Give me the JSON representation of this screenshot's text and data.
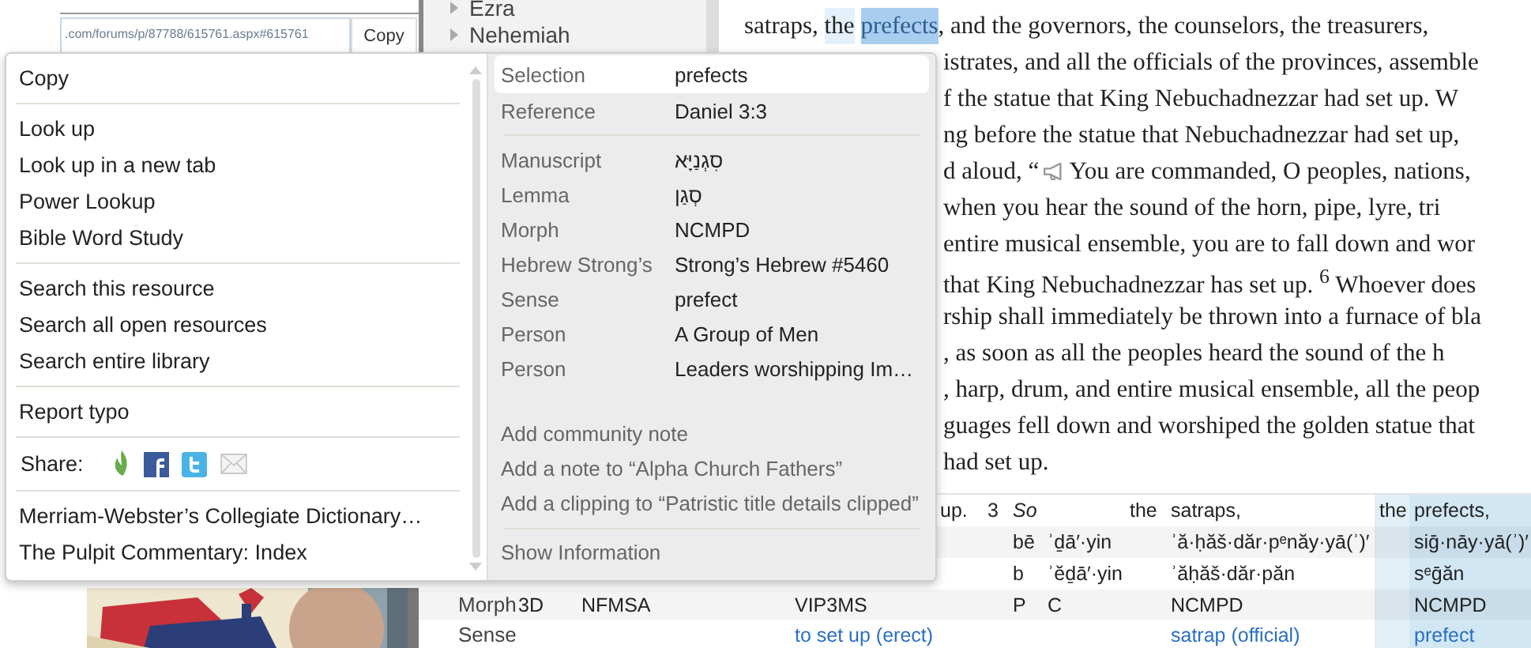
{
  "browser": {
    "url": ".com/forums/p/87788/615761.aspx#615761",
    "copy_button": "Copy"
  },
  "tree": [
    {
      "label": "Ezra",
      "expanded": false
    },
    {
      "label": "Nehemiah",
      "expanded": false
    }
  ],
  "reading": {
    "lines": [
      {
        "segments": [
          {
            "kind": "text",
            "text": "satraps, ",
            "selected": false,
            "hover": false
          },
          {
            "kind": "text",
            "text": "the",
            "selected": false,
            "hover": true
          },
          {
            "kind": "text",
            "text": "prefects",
            "selected": true,
            "hover": false
          },
          {
            "kind": "text",
            "text": ", and the governors, the counselors, the treasurers,",
            "selected": false,
            "hover": false
          }
        ]
      },
      {
        "segments": [
          {
            "kind": "text",
            "text": "istrates, and all the officials of the provinces, assemble",
            "selected": false,
            "hover": false
          }
        ]
      },
      {
        "segments": [
          {
            "kind": "text",
            "text": "f the statue that King Nebuchadnezzar had set up. W",
            "selected": false,
            "hover": false
          }
        ]
      },
      {
        "segments": [
          {
            "kind": "text",
            "text": "ng before the statue that Nebuchadnezzar had set up,",
            "selected": false,
            "hover": false
          }
        ]
      },
      {
        "segments": [
          {
            "kind": "text",
            "text": "d aloud, “",
            "selected": false,
            "hover": false
          },
          {
            "kind": "icon"
          },
          {
            "kind": "text",
            "text": "You are commanded, O peoples, nations,",
            "selected": false,
            "hover": false
          }
        ]
      },
      {
        "segments": [
          {
            "kind": "text",
            "text": "when you hear the sound of the horn, pipe, lyre, tri",
            "selected": false,
            "hover": false
          }
        ]
      },
      {
        "segments": [
          {
            "kind": "text",
            "text": "entire musical ensemble, you are to fall down and wor",
            "selected": false,
            "hover": false
          }
        ]
      },
      {
        "segments": [
          {
            "kind": "text",
            "text": "that King Nebuchadnezzar has set up. $^{6}$ Whoever does",
            "selected": false,
            "hover": false
          }
        ]
      },
      {
        "segments": [
          {
            "kind": "text",
            "text": "rship shall immediately be thrown into a furnace of bla",
            "selected": false,
            "hover": false
          }
        ]
      },
      {
        "segments": [
          {
            "kind": "text",
            "text": ", as soon as all the peoples heard the sound of the h",
            "selected": false,
            "hover": false
          }
        ]
      },
      {
        "segments": [
          {
            "kind": "text",
            "text": ", harp, drum, and entire musical ensemble, all the peop",
            "selected": false,
            "hover": false
          }
        ]
      },
      {
        "segments": [
          {
            "kind": "text",
            "text": "guages fell down and worshiped the golden statue that",
            "selected": false,
            "hover": false
          }
        ]
      },
      {
        "segments": [
          {
            "kind": "text",
            "text": "had set up.",
            "selected": false,
            "hover": false
          }
        ]
      }
    ]
  },
  "table": {
    "right_columns": [
      {
        "selected": false,
        "hover": false
      },
      {
        "selected": false,
        "hover": false
      },
      {
        "selected": false,
        "hover": false
      },
      {
        "selected": false,
        "hover": false
      },
      {
        "selected": false,
        "hover": false
      },
      {
        "selected": false,
        "hover": false
      },
      {
        "selected": false,
        "hover": true
      },
      {
        "selected": true,
        "hover": false
      }
    ],
    "rows": [
      {
        "kind": "text",
        "right": [
          {
            "kind": "text",
            "text": "up."
          },
          {
            "kind": "text",
            "text": "3"
          },
          {
            "kind": "text",
            "text": "So",
            "italic": true
          },
          {
            "kind": "blank"
          },
          {
            "kind": "text",
            "text": "the"
          },
          {
            "kind": "text",
            "text": "satraps,"
          },
          {
            "kind": "text",
            "text": "the"
          },
          {
            "kind": "text",
            "text": "prefects,"
          }
        ]
      },
      {
        "kind": "text",
        "right": [
          {
            "kind": "blank"
          },
          {
            "kind": "blank"
          },
          {
            "kind": "text",
            "text": "bē"
          },
          {
            "kind": "text",
            "text": "ʾḏā′·yin"
          },
          {
            "kind": "blank"
          },
          {
            "kind": "text",
            "text": "ʾă·ḥăš·dăr·pᵉnăy·yā(ʾ)′"
          },
          {
            "kind": "blank"
          },
          {
            "kind": "text",
            "text": "siḡ·nāy·yā(ʾ)′"
          }
        ]
      },
      {
        "kind": "text",
        "right": [
          {
            "kind": "blank"
          },
          {
            "kind": "blank"
          },
          {
            "kind": "text",
            "text": "b"
          },
          {
            "kind": "text",
            "text": "ʾĕḏā′·yin"
          },
          {
            "kind": "blank"
          },
          {
            "kind": "text",
            "text": "ʾăḥăš·dăr·păn"
          },
          {
            "kind": "blank"
          },
          {
            "kind": "text",
            "text": "sᵉḡăn"
          }
        ]
      },
      {
        "kind": "text",
        "label": "Morph",
        "left": [
          {
            "kind": "text",
            "text": "3D"
          },
          {
            "kind": "text",
            "text": "NFMSA"
          },
          {
            "kind": "text",
            "text": "VIP3MS"
          }
        ],
        "right": [
          {
            "kind": "blank"
          },
          {
            "kind": "blank"
          },
          {
            "kind": "text",
            "text": "P"
          },
          {
            "kind": "text",
            "text": "C"
          },
          {
            "kind": "blank"
          },
          {
            "kind": "text",
            "text": "NCMPD"
          },
          {
            "kind": "blank"
          },
          {
            "kind": "text",
            "text": "NCMPD"
          }
        ]
      },
      {
        "kind": "links",
        "label": "Sense",
        "left": [
          {
            "kind": "blank"
          },
          {
            "kind": "blank"
          },
          {
            "kind": "text",
            "text": "to set up (erect)"
          }
        ],
        "right": [
          {
            "kind": "blank"
          },
          {
            "kind": "blank"
          },
          {
            "kind": "blank"
          },
          {
            "kind": "blank"
          },
          {
            "kind": "blank"
          },
          {
            "kind": "text",
            "text": "satrap (official)"
          },
          {
            "kind": "blank"
          },
          {
            "kind": "text",
            "text": "prefect"
          }
        ]
      }
    ]
  },
  "context_menu": {
    "sections": [
      {
        "kind": "items",
        "items": [
          "Copy"
        ]
      },
      {
        "kind": "items",
        "items": [
          "Look up",
          "Look up in a new tab",
          "Power Lookup",
          "Bible Word Study"
        ]
      },
      {
        "kind": "items",
        "items": [
          "Search this resource",
          "Search all open resources",
          "Search entire library"
        ]
      },
      {
        "kind": "items",
        "items": [
          "Report typo"
        ]
      },
      {
        "kind": "share",
        "label": "Share:"
      },
      {
        "kind": "items",
        "items": [
          "Merriam-Webster’s Collegiate Dictionary…",
          "The Pulpit Commentary: Index"
        ]
      }
    ],
    "summary": [
      {
        "label": "Selection",
        "value": "prefects",
        "selected": true
      },
      {
        "label": "Reference",
        "value": "Daniel 3:3",
        "selected": false
      }
    ],
    "details": [
      {
        "label": "Manuscript",
        "value": "סִגְנַיָּא",
        "selected": false
      },
      {
        "label": "Lemma",
        "value": "סְגַן",
        "selected": false
      },
      {
        "label": "Morph",
        "value": "NCMPD",
        "selected": false
      },
      {
        "label": "Hebrew Strong’s",
        "value": "Strong’s Hebrew #5460",
        "selected": false
      },
      {
        "label": "Sense",
        "value": "prefect",
        "selected": false
      },
      {
        "label": "Person",
        "value": "A Group of Men",
        "selected": false
      },
      {
        "label": "Person",
        "value": "Leaders worshipping Im…",
        "selected": false
      }
    ],
    "actions": [
      "Add community note",
      "Add a note to “Alpha Church Fathers”",
      "Add a clipping to “Patristic title details clipped”"
    ],
    "footer": "Show Information"
  }
}
